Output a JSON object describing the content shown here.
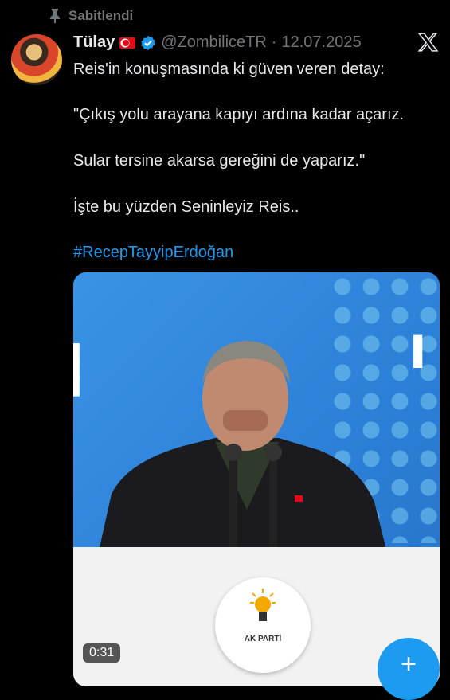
{
  "pinned": {
    "label": "Sabitlendi"
  },
  "author": {
    "name": "Tülay",
    "handle": "@ZombiliceTR",
    "separator": "·",
    "date": "12.07.2025"
  },
  "tweet": {
    "line1": "Reis'in konuşmasında ki güven veren detay:",
    "line2": "\"Çıkış yolu arayana kapıyı ardına kadar açarız.",
    "line3": "Sular tersine akarsa gereğini de yaparız.\"",
    "line4": "İşte bu yüzden Seninleyiz Reis..",
    "hashtag": "#RecepTayyipErdoğan"
  },
  "media": {
    "duration": "0:31",
    "emblem_text": "AK PARTİ"
  },
  "fab": {
    "label": "+"
  },
  "colors": {
    "accent": "#1d9bf0",
    "background": "#000000",
    "muted": "#71767b"
  },
  "icons": [
    "pin-icon",
    "flag-icon",
    "verified-icon",
    "x-logo-icon",
    "bulb-icon",
    "plus-icon"
  ]
}
